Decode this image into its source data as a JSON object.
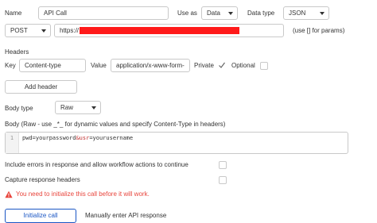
{
  "header": {
    "name_label": "Name",
    "name_value": "API Call",
    "use_as_label": "Use as",
    "use_as_value": "Data",
    "data_type_label": "Data type",
    "data_type_value": "JSON"
  },
  "request": {
    "method": "POST",
    "url_prefix": "https://",
    "params_hint": "(use [] for params)"
  },
  "headers_section": {
    "title": "Headers",
    "key_label": "Key",
    "key_value": "Content-type",
    "value_label": "Value",
    "value_value": "application/x-www-form-",
    "private_label": "Private",
    "private_checked": true,
    "optional_label": "Optional",
    "optional_checked": false,
    "add_header_label": "Add header"
  },
  "body": {
    "type_label": "Body type",
    "type_value": "Raw",
    "raw_label": "Body (Raw - use _*_ for dynamic values and specify Content-Type in headers)",
    "line_number": "1",
    "code_part1": "pwd=yourpassword",
    "code_part2": "&",
    "code_part3": "usr",
    "code_part4": "=yourusername"
  },
  "options": {
    "include_errors_label": "Include errors in response and allow workflow actions to continue",
    "capture_headers_label": "Capture response headers"
  },
  "warning": {
    "text": "You need to initialize this call before it will work."
  },
  "actions": {
    "initialize_label": "Initialize call",
    "manual_label": "Manually enter API response"
  },
  "colors": {
    "warning_red": "#e8453c",
    "accent_blue": "#1a56c4",
    "redaction": "#ff1a1a"
  }
}
